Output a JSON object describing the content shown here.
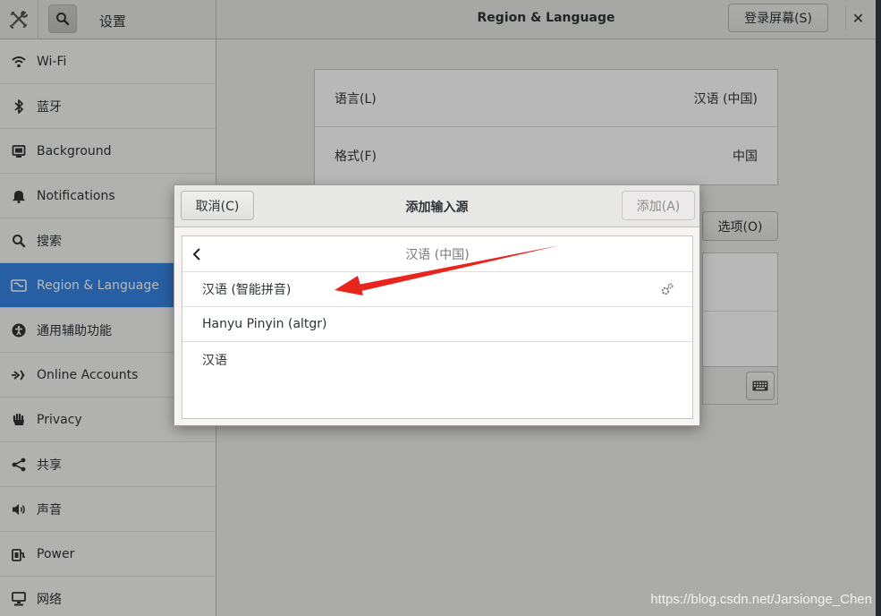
{
  "header": {
    "app_title": "设置",
    "page_title": "Region & Language",
    "login_screen_button": "登录屏幕(S)",
    "close_symbol": "✕"
  },
  "sidebar": {
    "items": [
      {
        "label": "Wi-Fi",
        "icon": "wifi-icon"
      },
      {
        "label": "蓝牙",
        "icon": "bluetooth-icon"
      },
      {
        "label": "Background",
        "icon": "background-icon"
      },
      {
        "label": "Notifications",
        "icon": "bell-icon"
      },
      {
        "label": "搜索",
        "icon": "search-icon"
      },
      {
        "label": "Region & Language",
        "icon": "region-icon",
        "active": true
      },
      {
        "label": "通用辅助功能",
        "icon": "accessibility-icon"
      },
      {
        "label": "Online Accounts",
        "icon": "online-accounts-icon"
      },
      {
        "label": "Privacy",
        "icon": "hand-icon"
      },
      {
        "label": "共享",
        "icon": "share-icon"
      },
      {
        "label": "声音",
        "icon": "speaker-icon"
      },
      {
        "label": "Power",
        "icon": "power-icon"
      },
      {
        "label": "网络",
        "icon": "network-icon"
      }
    ]
  },
  "main": {
    "language_label": "语言(L)",
    "language_value": "汉语 (中国)",
    "format_label": "格式(F)",
    "format_value": "中国",
    "options_button": "选项(O)"
  },
  "dialog": {
    "title": "添加输入源",
    "cancel_button": "取消(C)",
    "add_button": "添加(A)",
    "list_header": "汉语 (中国)",
    "items": [
      {
        "label": "汉语 (智能拼音)",
        "has_settings": true
      },
      {
        "label": "Hanyu Pinyin (altgr)"
      },
      {
        "label": "汉语"
      }
    ]
  },
  "annotation": {
    "arrow_color": "#e8251c"
  },
  "watermark": "https://blog.csdn.net/Jarsionge_Chen"
}
